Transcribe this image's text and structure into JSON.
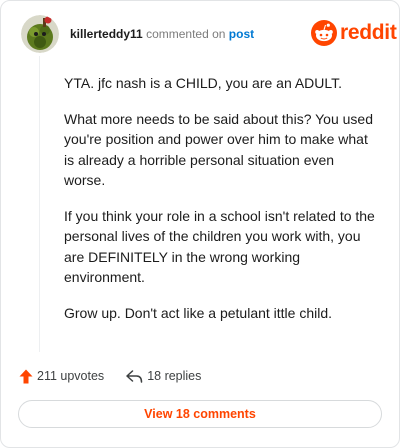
{
  "comment": {
    "username": "killerteddy11",
    "action_text": "commented on",
    "post_link": "post",
    "paragraphs": [
      "YTA. jfc nash is a CHILD, you are an ADULT.",
      "What more needs to be said about this? You used you're position and power over him to make what is already a horrible personal situation even worse.",
      "If you think your role in a school isn't related to the personal lives of the children you work with, you are DEFINITELY in the wrong working environment.",
      "Grow up. Don't act like a petulant ittle child."
    ]
  },
  "brand": {
    "name": "reddit",
    "color": "#ff4500",
    "icon": "reddit-snoo-icon"
  },
  "stats": {
    "upvotes": "211 upvotes",
    "replies": "18 replies",
    "upvote_icon": "upvote-arrow-icon",
    "reply_icon": "reply-arrow-icon"
  },
  "view_comments": "View 18 comments",
  "colors": {
    "accent": "#ff4500",
    "link": "#0079d3",
    "muted": "#7c7c7c"
  }
}
